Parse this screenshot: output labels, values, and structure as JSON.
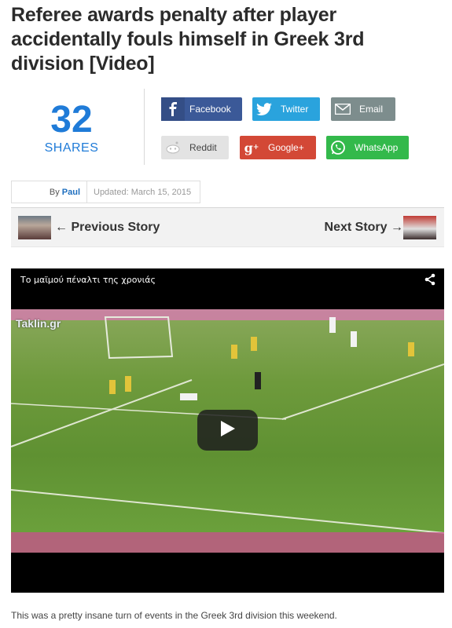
{
  "article": {
    "title": "Referee awards penalty after player accidentally fouls himself in Greek 3rd division [Video]",
    "caption": "This was a pretty insane turn of events in the Greek 3rd division this weekend."
  },
  "shares": {
    "count": "32",
    "label": "SHARES"
  },
  "share_buttons": {
    "facebook": "Facebook",
    "twitter": "Twitter",
    "email": "Email",
    "reddit": "Reddit",
    "google": "Google+",
    "whatsapp": "WhatsApp"
  },
  "byline": {
    "prefix": "By",
    "author": "Paul",
    "updated": "Updated: March 15, 2015"
  },
  "stories": {
    "previous": "← Previous Story",
    "next": "Next Story →"
  },
  "video": {
    "title": "Το μαϊμού πέναλτι της χρονιάς",
    "watermark": "Taklin.gr"
  },
  "icons": {
    "facebook": "facebook-icon",
    "twitter": "twitter-icon",
    "email": "mail-icon",
    "reddit": "reddit-icon",
    "google": "google-plus-icon",
    "whatsapp": "whatsapp-icon",
    "share": "share-icon",
    "play": "play-icon"
  },
  "colors": {
    "accent": "#1f7bd8",
    "facebook": "#3b5998",
    "twitter": "#2aa3dd",
    "email": "#7d8d8d",
    "reddit": "#e3e3e3",
    "google": "#d34836",
    "whatsapp": "#33b94b"
  }
}
